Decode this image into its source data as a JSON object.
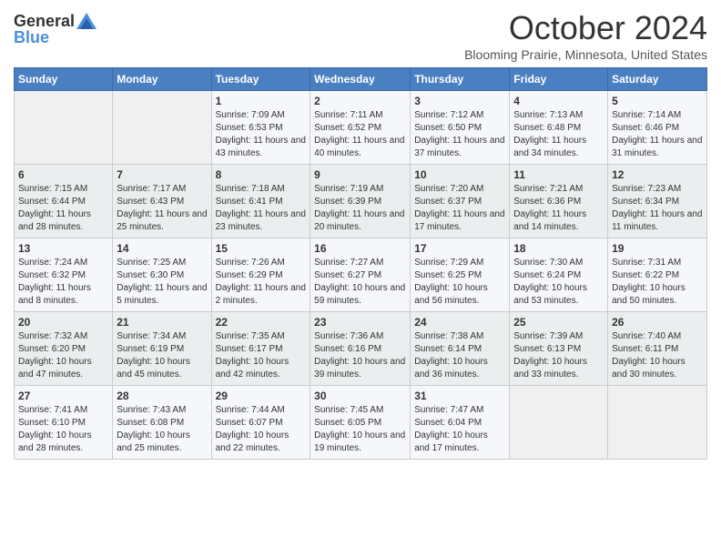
{
  "header": {
    "logo_general": "General",
    "logo_blue": "Blue",
    "month_title": "October 2024",
    "subtitle": "Blooming Prairie, Minnesota, United States"
  },
  "days_of_week": [
    "Sunday",
    "Monday",
    "Tuesday",
    "Wednesday",
    "Thursday",
    "Friday",
    "Saturday"
  ],
  "weeks": [
    [
      {
        "day": "",
        "sunrise": "",
        "sunset": "",
        "daylight": "",
        "empty": true
      },
      {
        "day": "",
        "sunrise": "",
        "sunset": "",
        "daylight": "",
        "empty": true
      },
      {
        "day": "1",
        "sunrise": "Sunrise: 7:09 AM",
        "sunset": "Sunset: 6:53 PM",
        "daylight": "Daylight: 11 hours and 43 minutes."
      },
      {
        "day": "2",
        "sunrise": "Sunrise: 7:11 AM",
        "sunset": "Sunset: 6:52 PM",
        "daylight": "Daylight: 11 hours and 40 minutes."
      },
      {
        "day": "3",
        "sunrise": "Sunrise: 7:12 AM",
        "sunset": "Sunset: 6:50 PM",
        "daylight": "Daylight: 11 hours and 37 minutes."
      },
      {
        "day": "4",
        "sunrise": "Sunrise: 7:13 AM",
        "sunset": "Sunset: 6:48 PM",
        "daylight": "Daylight: 11 hours and 34 minutes."
      },
      {
        "day": "5",
        "sunrise": "Sunrise: 7:14 AM",
        "sunset": "Sunset: 6:46 PM",
        "daylight": "Daylight: 11 hours and 31 minutes."
      }
    ],
    [
      {
        "day": "6",
        "sunrise": "Sunrise: 7:15 AM",
        "sunset": "Sunset: 6:44 PM",
        "daylight": "Daylight: 11 hours and 28 minutes."
      },
      {
        "day": "7",
        "sunrise": "Sunrise: 7:17 AM",
        "sunset": "Sunset: 6:43 PM",
        "daylight": "Daylight: 11 hours and 25 minutes."
      },
      {
        "day": "8",
        "sunrise": "Sunrise: 7:18 AM",
        "sunset": "Sunset: 6:41 PM",
        "daylight": "Daylight: 11 hours and 23 minutes."
      },
      {
        "day": "9",
        "sunrise": "Sunrise: 7:19 AM",
        "sunset": "Sunset: 6:39 PM",
        "daylight": "Daylight: 11 hours and 20 minutes."
      },
      {
        "day": "10",
        "sunrise": "Sunrise: 7:20 AM",
        "sunset": "Sunset: 6:37 PM",
        "daylight": "Daylight: 11 hours and 17 minutes."
      },
      {
        "day": "11",
        "sunrise": "Sunrise: 7:21 AM",
        "sunset": "Sunset: 6:36 PM",
        "daylight": "Daylight: 11 hours and 14 minutes."
      },
      {
        "day": "12",
        "sunrise": "Sunrise: 7:23 AM",
        "sunset": "Sunset: 6:34 PM",
        "daylight": "Daylight: 11 hours and 11 minutes."
      }
    ],
    [
      {
        "day": "13",
        "sunrise": "Sunrise: 7:24 AM",
        "sunset": "Sunset: 6:32 PM",
        "daylight": "Daylight: 11 hours and 8 minutes."
      },
      {
        "day": "14",
        "sunrise": "Sunrise: 7:25 AM",
        "sunset": "Sunset: 6:30 PM",
        "daylight": "Daylight: 11 hours and 5 minutes."
      },
      {
        "day": "15",
        "sunrise": "Sunrise: 7:26 AM",
        "sunset": "Sunset: 6:29 PM",
        "daylight": "Daylight: 11 hours and 2 minutes."
      },
      {
        "day": "16",
        "sunrise": "Sunrise: 7:27 AM",
        "sunset": "Sunset: 6:27 PM",
        "daylight": "Daylight: 10 hours and 59 minutes."
      },
      {
        "day": "17",
        "sunrise": "Sunrise: 7:29 AM",
        "sunset": "Sunset: 6:25 PM",
        "daylight": "Daylight: 10 hours and 56 minutes."
      },
      {
        "day": "18",
        "sunrise": "Sunrise: 7:30 AM",
        "sunset": "Sunset: 6:24 PM",
        "daylight": "Daylight: 10 hours and 53 minutes."
      },
      {
        "day": "19",
        "sunrise": "Sunrise: 7:31 AM",
        "sunset": "Sunset: 6:22 PM",
        "daylight": "Daylight: 10 hours and 50 minutes."
      }
    ],
    [
      {
        "day": "20",
        "sunrise": "Sunrise: 7:32 AM",
        "sunset": "Sunset: 6:20 PM",
        "daylight": "Daylight: 10 hours and 47 minutes."
      },
      {
        "day": "21",
        "sunrise": "Sunrise: 7:34 AM",
        "sunset": "Sunset: 6:19 PM",
        "daylight": "Daylight: 10 hours and 45 minutes."
      },
      {
        "day": "22",
        "sunrise": "Sunrise: 7:35 AM",
        "sunset": "Sunset: 6:17 PM",
        "daylight": "Daylight: 10 hours and 42 minutes."
      },
      {
        "day": "23",
        "sunrise": "Sunrise: 7:36 AM",
        "sunset": "Sunset: 6:16 PM",
        "daylight": "Daylight: 10 hours and 39 minutes."
      },
      {
        "day": "24",
        "sunrise": "Sunrise: 7:38 AM",
        "sunset": "Sunset: 6:14 PM",
        "daylight": "Daylight: 10 hours and 36 minutes."
      },
      {
        "day": "25",
        "sunrise": "Sunrise: 7:39 AM",
        "sunset": "Sunset: 6:13 PM",
        "daylight": "Daylight: 10 hours and 33 minutes."
      },
      {
        "day": "26",
        "sunrise": "Sunrise: 7:40 AM",
        "sunset": "Sunset: 6:11 PM",
        "daylight": "Daylight: 10 hours and 30 minutes."
      }
    ],
    [
      {
        "day": "27",
        "sunrise": "Sunrise: 7:41 AM",
        "sunset": "Sunset: 6:10 PM",
        "daylight": "Daylight: 10 hours and 28 minutes."
      },
      {
        "day": "28",
        "sunrise": "Sunrise: 7:43 AM",
        "sunset": "Sunset: 6:08 PM",
        "daylight": "Daylight: 10 hours and 25 minutes."
      },
      {
        "day": "29",
        "sunrise": "Sunrise: 7:44 AM",
        "sunset": "Sunset: 6:07 PM",
        "daylight": "Daylight: 10 hours and 22 minutes."
      },
      {
        "day": "30",
        "sunrise": "Sunrise: 7:45 AM",
        "sunset": "Sunset: 6:05 PM",
        "daylight": "Daylight: 10 hours and 19 minutes."
      },
      {
        "day": "31",
        "sunrise": "Sunrise: 7:47 AM",
        "sunset": "Sunset: 6:04 PM",
        "daylight": "Daylight: 10 hours and 17 minutes."
      },
      {
        "day": "",
        "sunrise": "",
        "sunset": "",
        "daylight": "",
        "empty": true
      },
      {
        "day": "",
        "sunrise": "",
        "sunset": "",
        "daylight": "",
        "empty": true
      }
    ]
  ]
}
